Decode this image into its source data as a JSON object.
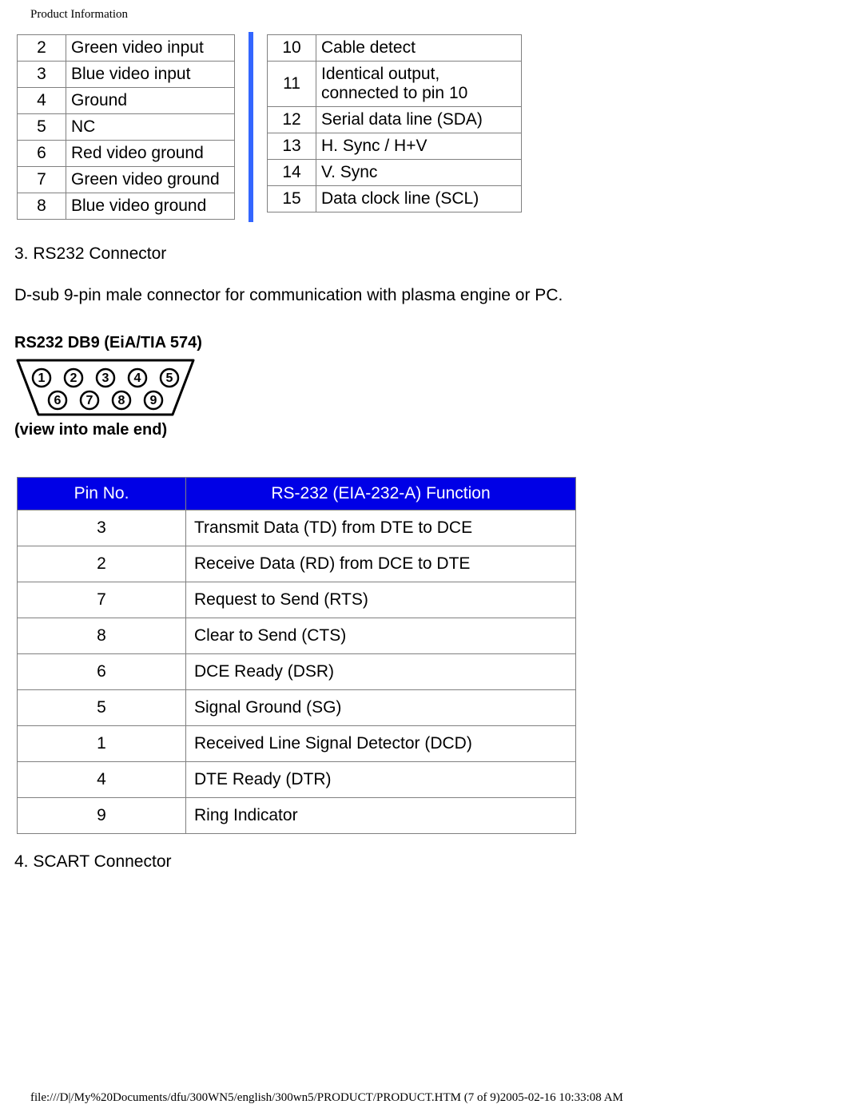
{
  "page_title": "Product Information",
  "footer": "file:///D|/My%20Documents/dfu/300WN5/english/300wn5/PRODUCT/PRODUCT.HTM (7 of 9)2005-02-16 10:33:08 AM",
  "top_pins_left": [
    {
      "num": "2",
      "desc": "Green video input"
    },
    {
      "num": "3",
      "desc": "Blue video input"
    },
    {
      "num": "4",
      "desc": "Ground"
    },
    {
      "num": "5",
      "desc": "NC"
    },
    {
      "num": "6",
      "desc": "Red video ground"
    },
    {
      "num": "7",
      "desc": "Green video ground"
    },
    {
      "num": "8",
      "desc": "Blue video ground"
    }
  ],
  "top_pins_right": [
    {
      "num": "10",
      "desc": "Cable detect"
    },
    {
      "num": "11",
      "desc": "Identical output, connected to pin 10"
    },
    {
      "num": "12",
      "desc": "Serial data line (SDA)"
    },
    {
      "num": "13",
      "desc": "H. Sync / H+V"
    },
    {
      "num": "14",
      "desc": "V. Sync"
    },
    {
      "num": "15",
      "desc": "Data clock line (SCL)"
    }
  ],
  "section_rs232_heading": "3. RS232 Connector",
  "section_rs232_body": "D-sub 9-pin male connector for communication with plasma engine or PC.",
  "db9_top_label": "RS232 DB9 (EiA/TIA 574)",
  "db9_bottom_label": "(view into male end)",
  "db9_pins": [
    "1",
    "2",
    "3",
    "4",
    "5",
    "6",
    "7",
    "8",
    "9"
  ],
  "rs232_table": {
    "head_pin": "Pin No.",
    "head_func": "RS-232 (EIA-232-A) Function",
    "rows": [
      {
        "pin": "3",
        "func": "Transmit Data (TD) from DTE to DCE"
      },
      {
        "pin": "2",
        "func": "Receive Data (RD) from DCE to DTE"
      },
      {
        "pin": "7",
        "func": "Request to Send (RTS)"
      },
      {
        "pin": "8",
        "func": "Clear to Send (CTS)"
      },
      {
        "pin": "6",
        "func": "DCE Ready (DSR)"
      },
      {
        "pin": "5",
        "func": "Signal Ground (SG)"
      },
      {
        "pin": "1",
        "func": "Received Line Signal Detector (DCD)"
      },
      {
        "pin": "4",
        "func": "DTE Ready (DTR)"
      },
      {
        "pin": "9",
        "func": "Ring Indicator"
      }
    ]
  },
  "section_scart_heading": "4. SCART Connector"
}
